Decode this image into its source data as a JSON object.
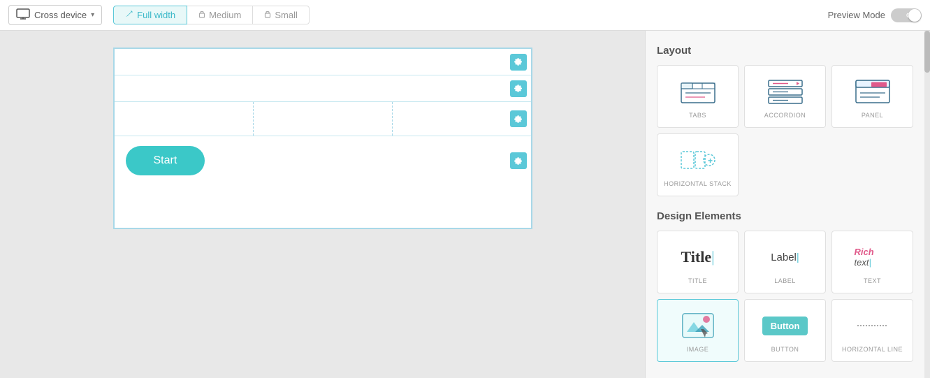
{
  "toolbar": {
    "device_label": "Cross device",
    "chevron": "▾",
    "width_tabs": [
      {
        "label": "Full width",
        "icon": "pencil",
        "locked": false,
        "active": true
      },
      {
        "label": "Medium",
        "icon": "lock",
        "locked": true,
        "active": false
      },
      {
        "label": "Small",
        "icon": "lock",
        "locked": true,
        "active": false
      }
    ],
    "preview_label": "Preview Mode",
    "toggle_state": "OFF"
  },
  "canvas": {
    "rows": [
      {
        "type": "empty",
        "id": "row1"
      },
      {
        "type": "empty",
        "id": "row2"
      },
      {
        "type": "columns",
        "id": "row3",
        "cols": 3
      },
      {
        "type": "button",
        "id": "row4",
        "button_label": "Start"
      }
    ]
  },
  "right_panel": {
    "layout_title": "Layout",
    "layout_items": [
      {
        "label": "TABS",
        "icon": "tabs"
      },
      {
        "label": "ACCORDION",
        "icon": "accordion"
      },
      {
        "label": "PANEL",
        "icon": "panel"
      },
      {
        "label": "HORIZONTAL STACK",
        "icon": "hstack"
      }
    ],
    "design_title": "Design Elements",
    "design_items": [
      {
        "label": "TITLE",
        "icon": "title"
      },
      {
        "label": "LABEL",
        "icon": "label"
      },
      {
        "label": "TEXT",
        "icon": "text"
      },
      {
        "label": "IMAGE",
        "icon": "image"
      },
      {
        "label": "BUTTON",
        "icon": "button"
      },
      {
        "label": "HORIZONTAL LINE",
        "icon": "hline"
      }
    ]
  }
}
